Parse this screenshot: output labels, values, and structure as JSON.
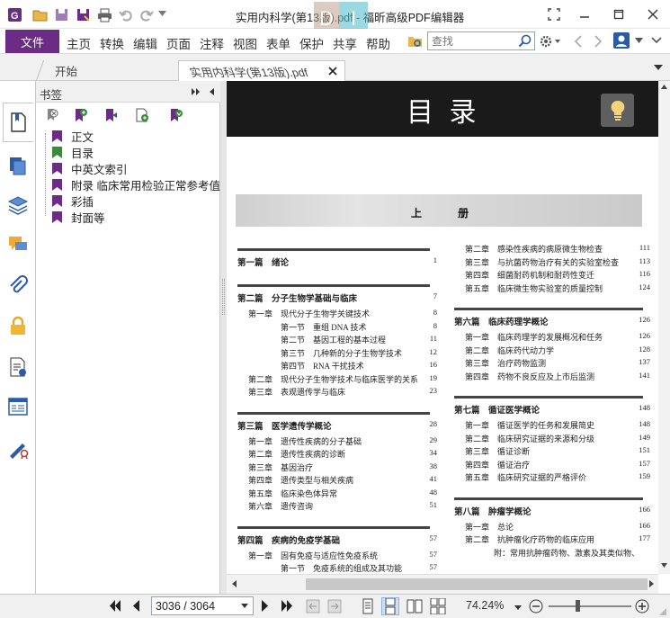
{
  "app": {
    "title": "实用内科学(第13版).pdf - 福昕高级PDF编辑器",
    "watermark_letters": [
      "D",
      "I"
    ]
  },
  "menu": {
    "file": "文件",
    "items": [
      "主页",
      "转换",
      "编辑",
      "页面",
      "注释",
      "视图",
      "表单",
      "保护",
      "共享",
      "帮助"
    ]
  },
  "search": {
    "placeholder": "查找"
  },
  "tabs": [
    {
      "label": "开始"
    },
    {
      "label": "实用内科学(第13版).pdf"
    }
  ],
  "bookmarks": {
    "title": "书签",
    "items": [
      "正文",
      "目录",
      "中英文索引",
      "附录 临床常用检验正常参考值",
      "彩插",
      "封面等"
    ]
  },
  "status": {
    "page": "3036 / 3064",
    "zoom": "74.24%"
  },
  "colors": {
    "accent": "#6a2c84",
    "bookmark_flag": "#6a2c84",
    "bookmark_flag_active": "#3a8a3a"
  },
  "page": {
    "heading": "目 录",
    "volume": "上 册",
    "left": [
      {
        "kind": "part",
        "label": "第一篇　绪论",
        "page": "1"
      },
      {
        "kind": "part",
        "label": "第二篇　分子生物学基础与临床",
        "page": "7"
      },
      {
        "kind": "ch",
        "label": "第一章　现代分子生物学关键技术",
        "page": "8"
      },
      {
        "kind": "sec",
        "label": "第一节　重组 DNA 技术",
        "page": "8"
      },
      {
        "kind": "sec",
        "label": "第二节　基因工程的基本过程",
        "page": "11"
      },
      {
        "kind": "sec",
        "label": "第三节　几种新的分子生物学技术",
        "page": "12"
      },
      {
        "kind": "sec",
        "label": "第四节　RNA 干扰技术",
        "page": "16"
      },
      {
        "kind": "ch",
        "label": "第二章　现代分子生物学技术与临床医学的关系",
        "page": "19"
      },
      {
        "kind": "ch",
        "label": "第三章　表观遗传学与临床",
        "page": "23"
      },
      {
        "kind": "part",
        "label": "第三篇　医学遗传学概论",
        "page": "28"
      },
      {
        "kind": "ch",
        "label": "第一章　遗传性疾病的分子基础",
        "page": "29"
      },
      {
        "kind": "ch",
        "label": "第二章　遗传性疾病的诊断",
        "page": "34"
      },
      {
        "kind": "ch",
        "label": "第三章　基因治疗",
        "page": "38"
      },
      {
        "kind": "ch",
        "label": "第四章　遗传类型与相关疾病",
        "page": "41"
      },
      {
        "kind": "ch",
        "label": "第五章　临床染色体异常",
        "page": "48"
      },
      {
        "kind": "ch",
        "label": "第六章　遗传咨询",
        "page": "51"
      },
      {
        "kind": "part",
        "label": "第四篇　疾病的免疫学基础",
        "page": "57"
      },
      {
        "kind": "ch",
        "label": "第一章　固有免疫与适应性免疫系统",
        "page": "57"
      },
      {
        "kind": "sec",
        "label": "第一节　免疫系统的组成及其功能",
        "page": "57"
      }
    ],
    "right": [
      {
        "kind": "ch",
        "label": "第二章　感染性疾病的病原微生物检查",
        "page": "111"
      },
      {
        "kind": "ch",
        "label": "第三章　与抗菌药物治疗有关的实验室检查",
        "page": "113"
      },
      {
        "kind": "ch",
        "label": "第四章　细菌耐药机制和耐药性变迁",
        "page": "116"
      },
      {
        "kind": "ch",
        "label": "第五章　临床微生物实验室的质量控制",
        "page": "124"
      },
      {
        "kind": "part",
        "label": "第六篇　临床药理学概论",
        "page": "126"
      },
      {
        "kind": "ch",
        "label": "第一章　临床药理学的发展概况和任务",
        "page": "126"
      },
      {
        "kind": "ch",
        "label": "第二章　临床药代动力学",
        "page": "128"
      },
      {
        "kind": "ch",
        "label": "第三章　治疗药物监测",
        "page": "137"
      },
      {
        "kind": "ch",
        "label": "第四章　药物不良反应及上市后监测",
        "page": "141"
      },
      {
        "kind": "part",
        "label": "第七篇　循证医学概论",
        "page": "148"
      },
      {
        "kind": "ch",
        "label": "第一章　循证医学的任务和发展简史",
        "page": "148"
      },
      {
        "kind": "ch",
        "label": "第二章　临床研究证据的来源和分级",
        "page": "149"
      },
      {
        "kind": "ch",
        "label": "第三章　循证诊断",
        "page": "151"
      },
      {
        "kind": "ch",
        "label": "第四章　循证治疗",
        "page": "157"
      },
      {
        "kind": "ch",
        "label": "第五章　临床研究证据的严格评价",
        "page": "159"
      },
      {
        "kind": "part",
        "label": "第八篇　肿瘤学概论",
        "page": "166"
      },
      {
        "kind": "ch",
        "label": "第一章　总论",
        "page": "166"
      },
      {
        "kind": "ch",
        "label": "第二章　抗肿瘤化疗药物的临床应用",
        "page": "177"
      },
      {
        "kind": "note",
        "label": "附：常用抗肿瘤药物、激素及其类似物、",
        "page": ""
      }
    ]
  }
}
